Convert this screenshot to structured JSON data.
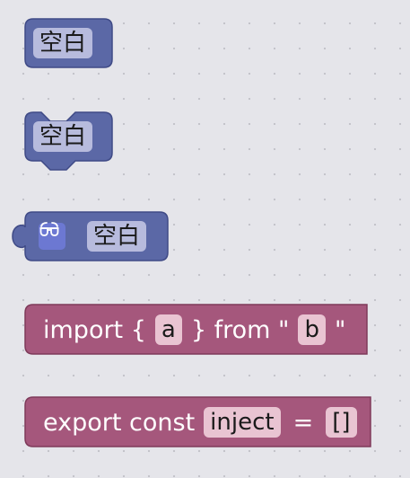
{
  "workspace": {
    "blocks": [
      {
        "type": "text",
        "label": "空白"
      },
      {
        "type": "statement",
        "label": "空白"
      },
      {
        "type": "value",
        "icon": "glasses-icon",
        "label": "空白"
      },
      {
        "type": "import",
        "keyword": "import {",
        "name": "a",
        "middle": "} from \"",
        "source": "b",
        "end": "\""
      },
      {
        "type": "export",
        "keyword": "export const",
        "name": "inject",
        "equals": "=",
        "value": "[]"
      }
    ]
  },
  "colors": {
    "background": "#e5e5ea",
    "grid_dot": "#c2c2c8",
    "block_blue": "#5b68a6",
    "block_blue_border": "#3f4a86",
    "field_blue": "#b7bbdd",
    "block_pink": "#a5577c",
    "block_pink_border": "#7e3a5a",
    "field_pink": "#e9c4d2"
  }
}
